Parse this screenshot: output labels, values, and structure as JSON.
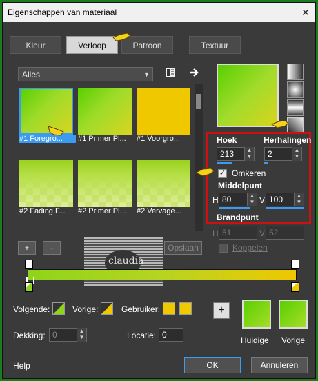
{
  "window": {
    "title": "Eigenschappen van materiaal",
    "close_glyph": "✕"
  },
  "tabs": [
    {
      "label": "Kleur",
      "active": false
    },
    {
      "label": "Verloop",
      "active": true
    },
    {
      "label": "Patroon",
      "active": false
    },
    {
      "label": "Textuur",
      "active": false
    }
  ],
  "category_select": {
    "value": "Alles"
  },
  "thumbnails": [
    {
      "caption": "#1 Foregro...",
      "selected": true
    },
    {
      "caption": "#1 Primer Pl...",
      "selected": false
    },
    {
      "caption": "#1 Voorgro...",
      "selected": false
    },
    {
      "caption": "#2 Fading F...",
      "selected": false
    },
    {
      "caption": "#2 Primer Pl...",
      "selected": false
    },
    {
      "caption": "#2 Vervage...",
      "selected": false
    }
  ],
  "gradient_settings": {
    "hoek_label": "Hoek",
    "hoek_value": "213",
    "herhalingen_label": "Herhalingen",
    "herhalingen_value": "2",
    "omkeren_label": "Omkeren",
    "omkeren_checked": true,
    "middelpunt_label": "Middelpunt",
    "h_label": "H",
    "h_value": "80",
    "v_label": "V",
    "v_value": "100",
    "brandpunt_label": "Brandpunt",
    "bh_value": "51",
    "bv_value": "52",
    "koppelen_label": "Koppelen"
  },
  "editor": {
    "add": "+",
    "remove": "-",
    "opslaan": "Opslaan"
  },
  "bottom": {
    "volgende_label": "Volgende:",
    "vorige_label": "Vorige:",
    "gebruiker_label": "Gebruiker:",
    "dekking_label": "Dekking:",
    "dekking_value": "0",
    "locatie_label": "Locatie:",
    "locatie_value": "0",
    "add_swatch": "+",
    "huidige_label": "Huidige",
    "vorige_swatch_label": "Vorige",
    "help": "Help",
    "ok": "OK",
    "annuleren": "Annuleren"
  },
  "watermark": {
    "text": "claudia"
  },
  "colors": {
    "accent_red": "#d01010",
    "selection_blue": "#3a9bf0",
    "green": "#8fd41a",
    "yellow": "#efc800"
  }
}
